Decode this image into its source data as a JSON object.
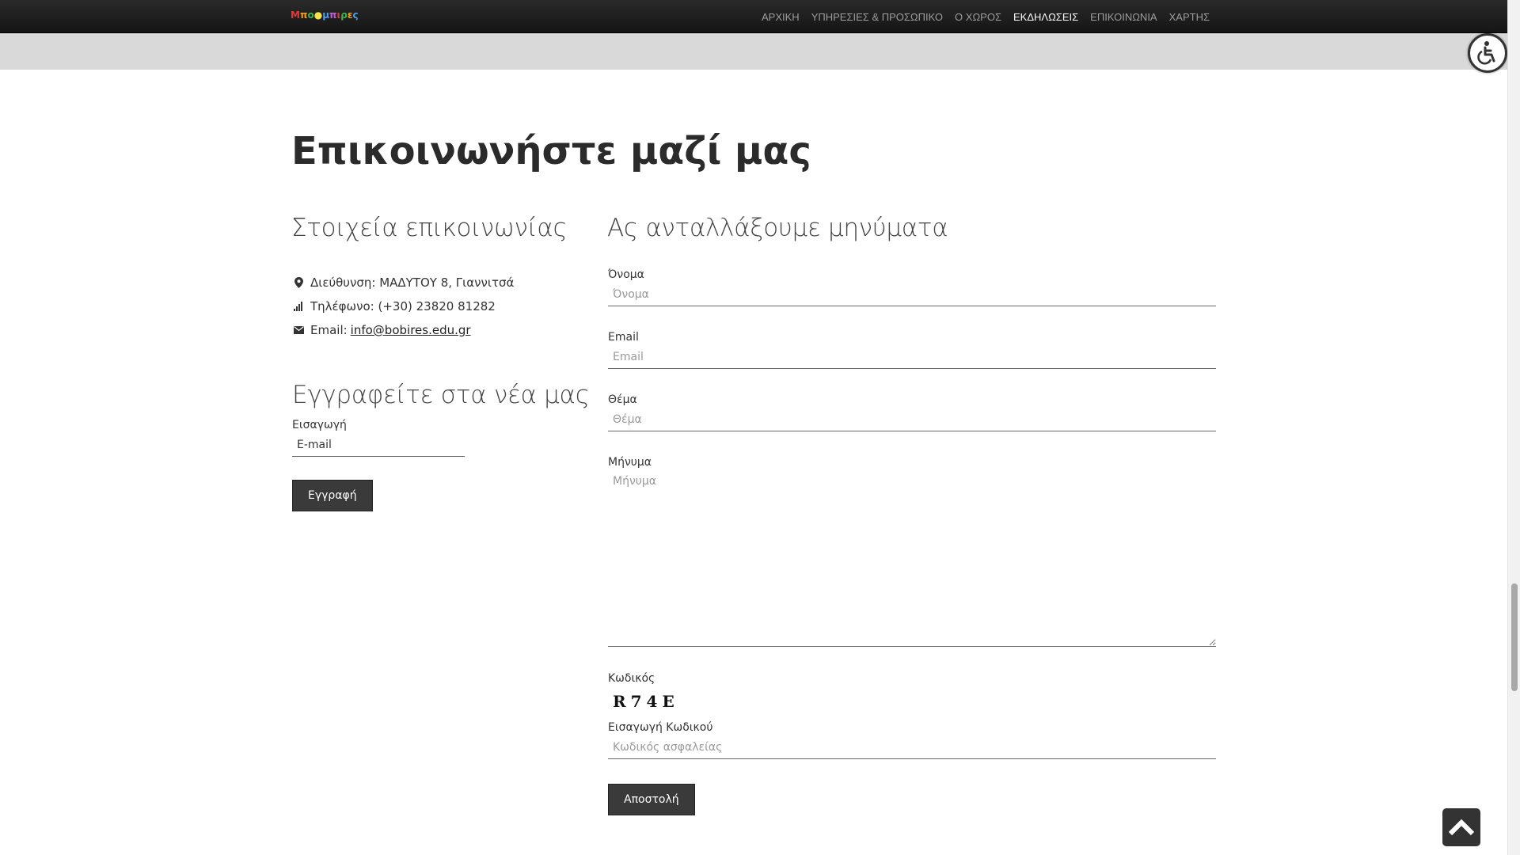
{
  "nav": {
    "logo_chars": [
      {
        "ch": "Μ",
        "color": "#e03a3a"
      },
      {
        "ch": "π",
        "color": "#f0a020"
      },
      {
        "ch": "ο",
        "color": "#3cb44b"
      },
      {
        "ch": "●",
        "color": "#f7e04a"
      },
      {
        "ch": "μ",
        "color": "#4aa0f0"
      },
      {
        "ch": "π",
        "color": "#c060d0"
      },
      {
        "ch": "ι",
        "color": "#e03a3a"
      },
      {
        "ch": "ρ",
        "color": "#3cb44b"
      },
      {
        "ch": "ε",
        "color": "#f0a020"
      },
      {
        "ch": "ς",
        "color": "#4aa0f0"
      }
    ],
    "items": [
      {
        "label": "ΑΡΧΙΚΗ",
        "active": false
      },
      {
        "label": "ΥΠΗΡΕΣΙΕΣ & ΠΡΟΣΩΠΙΚΟ",
        "active": false
      },
      {
        "label": "Ο ΧΩΡΟΣ",
        "active": false
      },
      {
        "label": "ΕΚΔΗΛΩΣΕΙΣ",
        "active": true
      },
      {
        "label": "ΕΠΙΚΟΙΝΩΝΙΑ",
        "active": false
      },
      {
        "label": "ΧΑΡΤΗΣ",
        "active": false
      }
    ]
  },
  "page": {
    "title": "Επικοινωνήστε μαζί μας"
  },
  "contact": {
    "heading": "Στοιχεία επικοινωνίας",
    "address": "Διεύθυνση: ΜΑΔΥΤΟΥ 8, Γιαννιτσά",
    "phone": "Τηλέφωνο: (+30) 23820 81282",
    "email_prefix": "Email: ",
    "email_link": "info@bobires.edu.gr"
  },
  "newsletter": {
    "heading": "Εγγραφείτε στα νέα μας",
    "label": "Εισαγωγή",
    "value": "E-mail",
    "button": "Εγγραφή"
  },
  "message_form": {
    "heading": "Ας ανταλλάξουμε μηνύματα",
    "name_label": "Όνομα",
    "name_placeholder": "Όνομα",
    "email_label": "Email",
    "email_placeholder": "Email",
    "subject_label": "Θέμα",
    "subject_placeholder": "Θέμα",
    "message_label": "Μήνυμα",
    "message_placeholder": "Μήνυμα",
    "code_label": "Κωδικός",
    "captcha": "R74E",
    "code_input_label": "Εισαγωγή Κωδικού",
    "code_placeholder": "Κωδικός ασφαλείας",
    "submit": "Αποστολή"
  },
  "colors": {
    "navbar": "#1c1c1c",
    "nav_text": "#9d9d9d",
    "button_bg": "#3a3a3a"
  }
}
